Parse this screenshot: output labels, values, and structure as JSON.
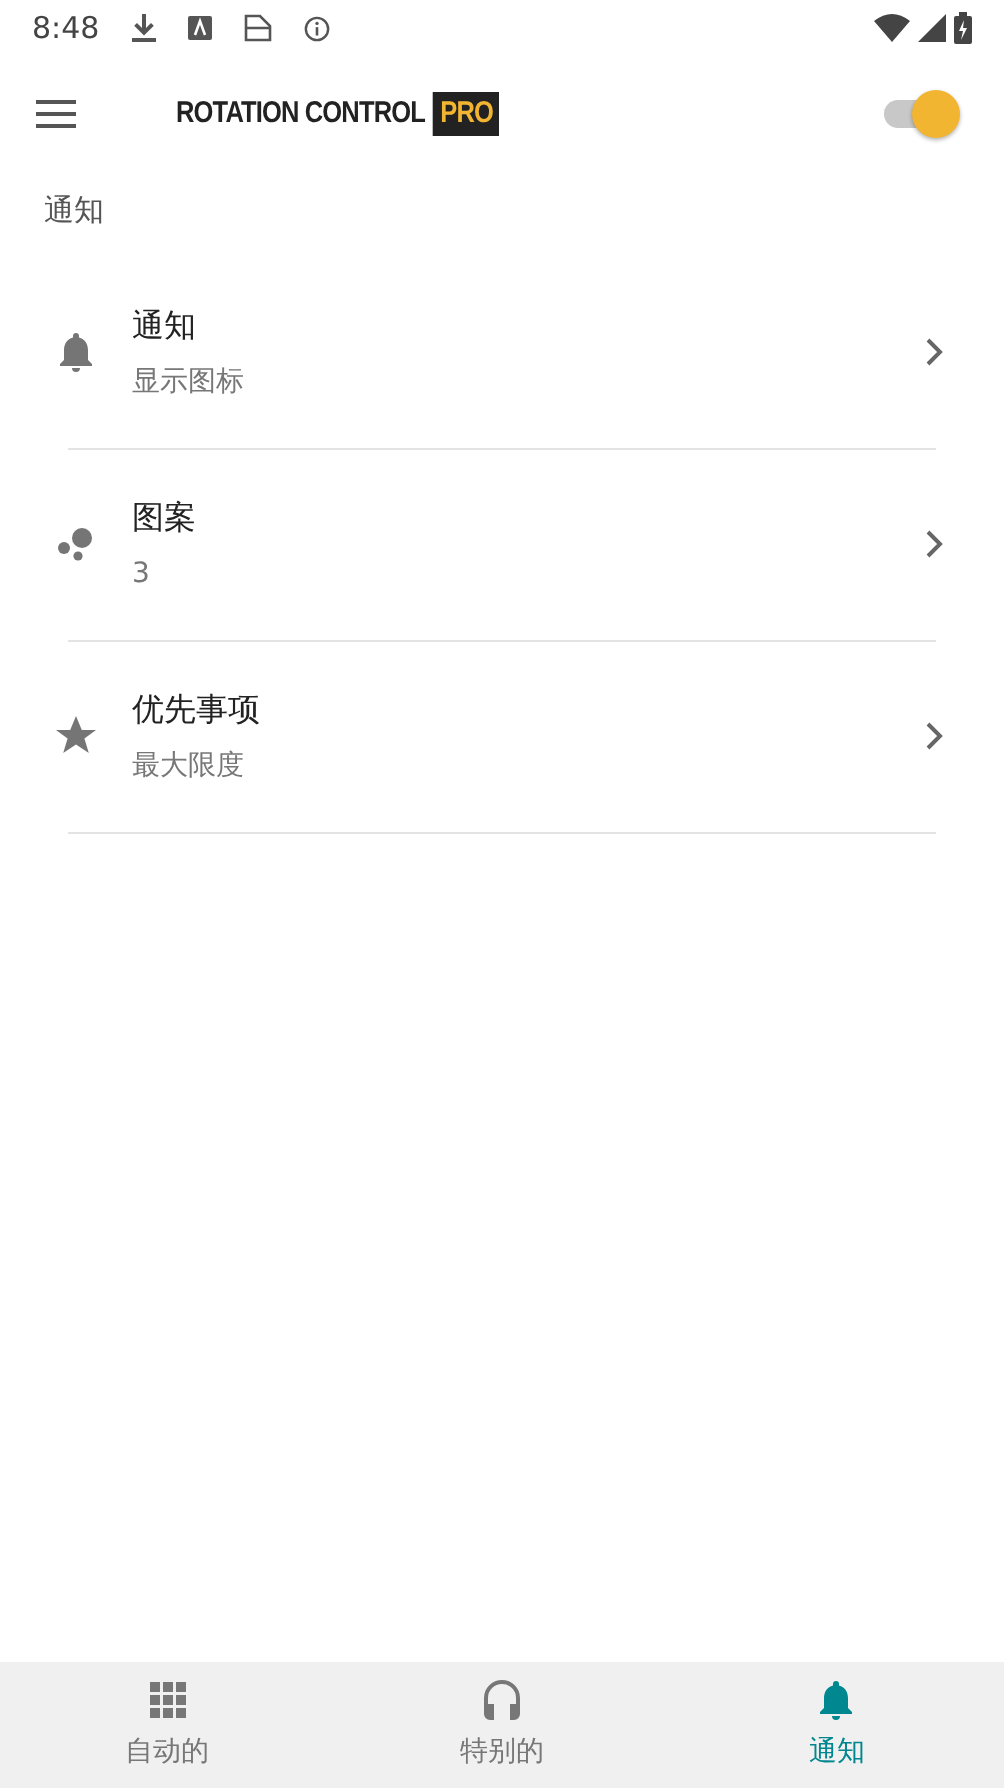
{
  "status_bar": {
    "time": "8:48"
  },
  "app_bar": {
    "logo_text": "ROTATION CONTROL",
    "logo_badge": "PRO",
    "switch_on": true
  },
  "section_title": "通知",
  "items": [
    {
      "title": "通知",
      "subtitle": "显示图标"
    },
    {
      "title": "图案",
      "subtitle": "3"
    },
    {
      "title": "优先事项",
      "subtitle": "最大限度"
    }
  ],
  "bottom_nav": [
    {
      "label": "自动的",
      "selected": false
    },
    {
      "label": "特别的",
      "selected": false
    },
    {
      "label": "通知",
      "selected": true
    }
  ]
}
